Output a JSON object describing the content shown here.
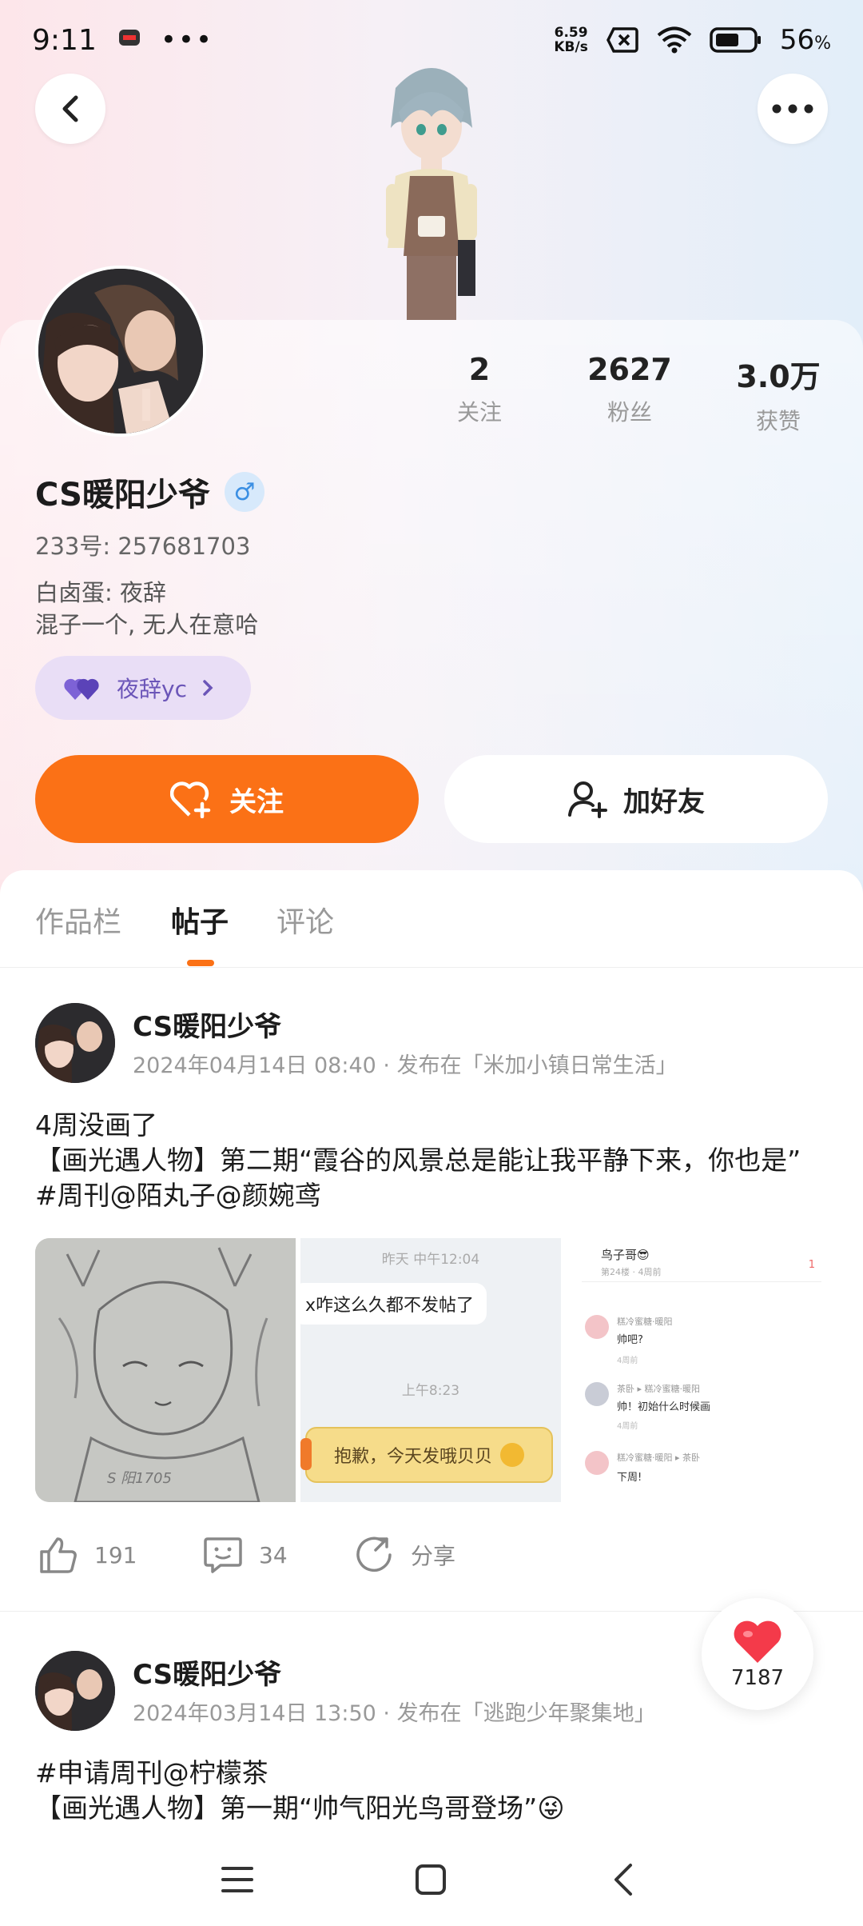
{
  "status_bar": {
    "time": "9:11",
    "net_speed_value": "6.59",
    "net_speed_unit": "KB/s",
    "battery": "56",
    "battery_unit": "%"
  },
  "profile": {
    "nickname": "CS暖阳少爷",
    "gender_symbol": "♂",
    "uid": "233号: 257681703",
    "bio_line1": "白卤蛋: 夜辞",
    "bio_line2": "混子一个, 无人在意哈",
    "cp_name": "夜辞yc",
    "stats": [
      {
        "value": "2",
        "label": "关注"
      },
      {
        "value": "2627",
        "label": "粉丝"
      },
      {
        "value": "3.0万",
        "label": "获赞"
      }
    ],
    "follow_label": "关注",
    "add_friend_label": "加好友"
  },
  "tabs": [
    {
      "label": "作品栏",
      "active": false
    },
    {
      "label": "帖子",
      "active": true
    },
    {
      "label": "评论",
      "active": false
    }
  ],
  "posts": [
    {
      "author": "CS暖阳少爷",
      "meta": "2024年04月14日 08:40 · 发布在「米加小镇日常生活」",
      "lines": [
        "4周没画了",
        "【画光遇人物】第二期“霞谷的风景总是能让我平静下来，你也是”",
        "#周刊@陌丸子@颜婉鸢"
      ],
      "images": {
        "sketch_signature": "S 阳1705",
        "chat_time1": "昨天 中午12:04",
        "chat_msg1": "x咋这么久都不发帖了",
        "chat_time2": "上午8:23",
        "chat_msg2": "抱歉，今天发哦贝贝",
        "comments_title": "鸟子哥😎",
        "comments_sub": "第24楼 · 4周前",
        "comments_like": "1",
        "comments": [
          {
            "name": "糕冷蜜糖·暖阳",
            "text": "帅吧?",
            "time": "4周前"
          },
          {
            "name": "茶卧 ▸ 糕冷蜜糖·暖阳",
            "text": "帅！初始什么时候画",
            "time": "4周前"
          },
          {
            "name": "糕冷蜜糖·暖阳 ▸ 茶卧",
            "text": "下周!",
            "time": ""
          }
        ]
      },
      "likes": "191",
      "comments_count": "34",
      "share_label": "分享"
    },
    {
      "author": "CS暖阳少爷",
      "meta": "2024年03月14日 13:50 · 发布在「逃跑少年聚集地」",
      "lines": [
        "#申请周刊@柠檬茶",
        "【画光遇人物】第一期“帅气阳光鸟哥登场”😜"
      ]
    }
  ],
  "like_fab_count": "7187",
  "colors": {
    "accent": "#fb7116",
    "cp_chip_bg": "#e9def6",
    "cp_text": "#6b55b8",
    "heart_red": "#f43a4a"
  }
}
